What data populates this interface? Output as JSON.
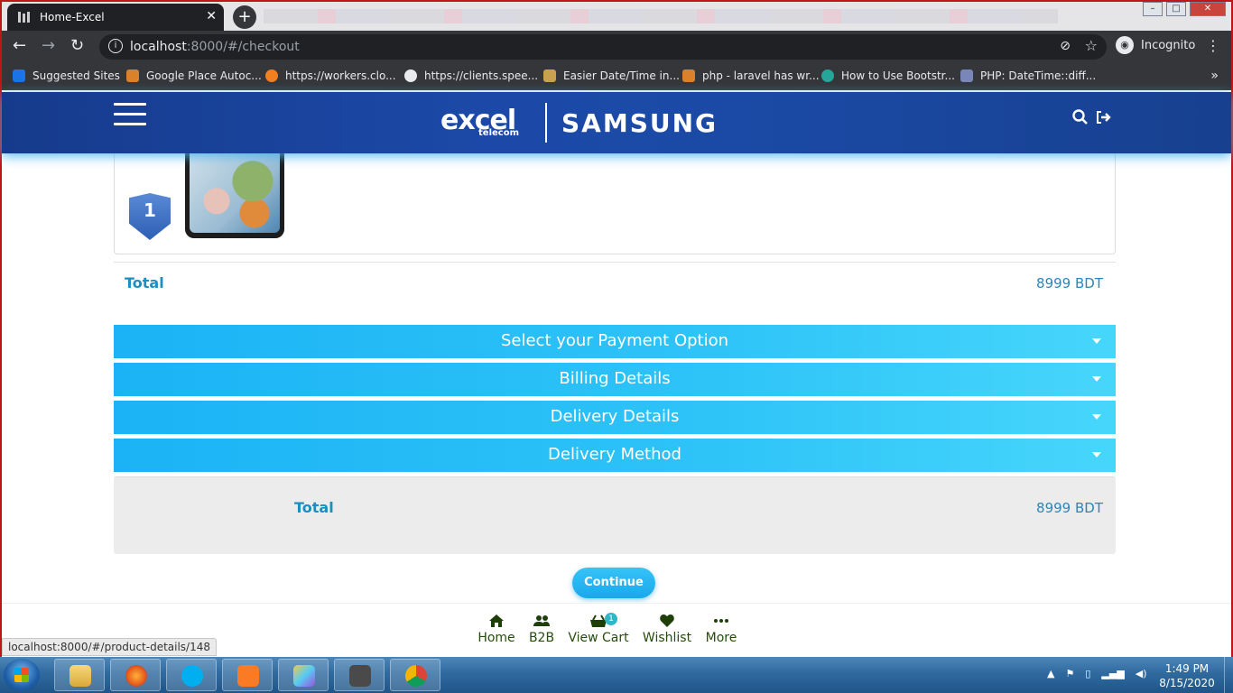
{
  "browser": {
    "tab_title": "Home-Excel",
    "tab_close": "✕",
    "new_tab": "+",
    "url_host": "localhost",
    "url_rest": ":8000/#/checkout",
    "profile_label": "Incognito",
    "bookmarks": [
      {
        "label": "Suggested Sites",
        "color": "#1a73e8"
      },
      {
        "label": "Google Place Autoc...",
        "color": "#d9822b"
      },
      {
        "label": "https://workers.clo...",
        "color": "#f38020"
      },
      {
        "label": "https://clients.spee...",
        "color": "#e8eaed"
      },
      {
        "label": "Easier Date/Time in...",
        "color": "#c8a050"
      },
      {
        "label": "php - laravel has wr...",
        "color": "#d9822b"
      },
      {
        "label": "How to Use Bootstr...",
        "color": "#26a69a"
      },
      {
        "label": "PHP: DateTime::diff...",
        "color": "#7a86b8"
      }
    ],
    "status_url": "localhost:8000/#/product-details/148"
  },
  "header": {
    "logo_excel": "excel",
    "logo_telecom": "telecom",
    "logo_samsung": "SAMSUNG"
  },
  "checkout": {
    "badge_text": "1",
    "total_label": "Total",
    "total_value": "8999 BDT",
    "sections": [
      {
        "label": "Select your Payment Option"
      },
      {
        "label": "Billing Details"
      },
      {
        "label": "Delivery Details"
      },
      {
        "label": "Delivery Method"
      }
    ],
    "summary_label": "Total",
    "summary_value": "8999 BDT",
    "continue_label": "Continue"
  },
  "bottom_nav": [
    {
      "label": "Home",
      "icon": "home-icon"
    },
    {
      "label": "B2B",
      "icon": "users-icon"
    },
    {
      "label": "View Cart",
      "icon": "basket-icon",
      "count": "1"
    },
    {
      "label": "Wishlist",
      "icon": "heart-icon"
    },
    {
      "label": "More",
      "icon": "more-icon"
    }
  ],
  "taskbar": {
    "time": "1:49 PM",
    "date": "8/15/2020"
  }
}
